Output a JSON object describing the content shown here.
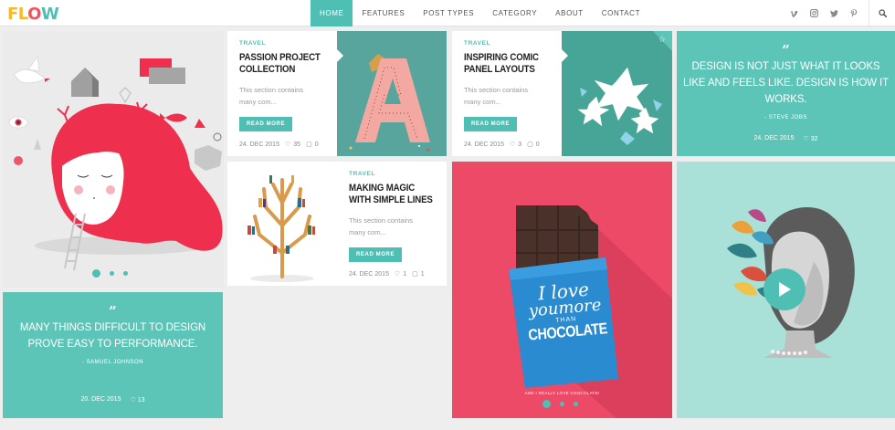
{
  "header": {
    "logo": {
      "p1": "FL",
      "p2": "O",
      "p3": "W"
    },
    "nav": [
      {
        "label": "HOME",
        "active": true
      },
      {
        "label": "FEATURES",
        "active": false
      },
      {
        "label": "POST TYPES",
        "active": false
      },
      {
        "label": "CATEGORY",
        "active": false
      },
      {
        "label": "ABOUT",
        "active": false
      },
      {
        "label": "CONTACT",
        "active": false
      }
    ],
    "social_icons": [
      "vimeo-icon",
      "instagram-icon",
      "twitter-icon",
      "pinterest-icon"
    ],
    "search_icon": "search-icon"
  },
  "posts": [
    {
      "category": "TRAVEL",
      "title": "PASSION PROJECT COLLECTION",
      "excerpt": "This section contains many com...",
      "read_more": "READ MORE",
      "date": "24. DEC 2015",
      "likes": "35",
      "comments": "0"
    },
    {
      "category": "TRAVEL",
      "title": "INSPIRING COMIC PANEL LAYOUTS",
      "excerpt": "This section contains many com...",
      "read_more": "READ MORE",
      "date": "24. DEC 2015",
      "likes": "3",
      "comments": "0"
    },
    {
      "category": "TRAVEL",
      "title": "MAKING MAGIC WITH SIMPLE LINES",
      "excerpt": "This section contains many com...",
      "read_more": "READ MORE",
      "date": "24. DEC 2015",
      "likes": "1",
      "comments": "1"
    }
  ],
  "quotes": [
    {
      "mark": "”",
      "text": "DESIGN IS NOT JUST WHAT IT LOOKS LIKE AND FEELS LIKE. DESIGN IS HOW IT WORKS.",
      "author": "- STEVE JOBS",
      "date": "24. DEC 2015",
      "likes": "32"
    },
    {
      "mark": "”",
      "text": "MANY THINGS DIFFICULT TO DESIGN PROVE EASY TO PERFORMANCE.",
      "author": "- SAMUEL JOHNSON",
      "date": "20. DEC 2015",
      "likes": "13"
    }
  ],
  "chocolate": {
    "line1": "I love",
    "line2": "you",
    "line3": "more",
    "line4": "THAN",
    "line5": "CHOCOLATE",
    "caption": "AND I REALLY LOVE CHOCOLATE!"
  },
  "colors": {
    "accent": "#4fbfb3",
    "pink": "#ec4a66",
    "mint": "#a9e0d8",
    "logo_yellow": "#f7b82c",
    "logo_red": "#f0535e"
  }
}
